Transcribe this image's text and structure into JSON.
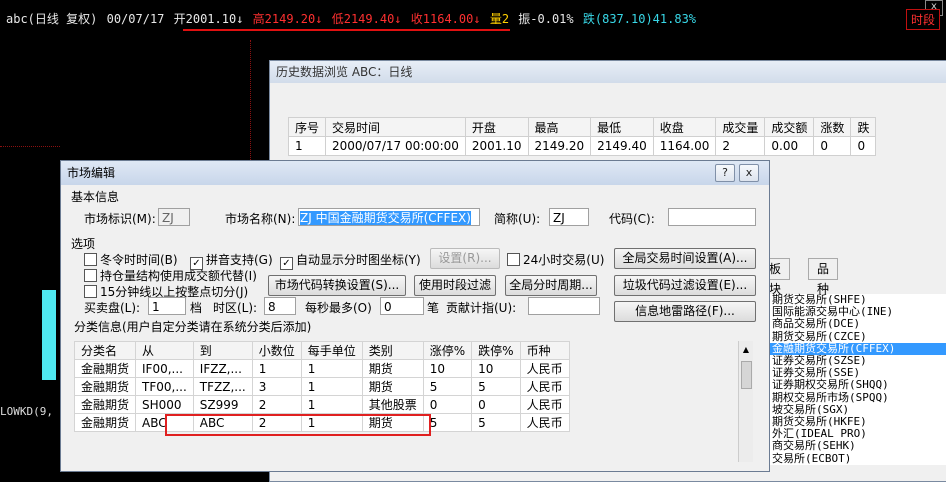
{
  "ticker": {
    "symbol": "abc(日线 复权)",
    "date": "00/07/17",
    "open": "开2001.10↓",
    "high": "高2149.20↓",
    "low": "低2149.40↓",
    "close": "收1164.00↓",
    "volume": "量2",
    "amplitude": "振-0.01%",
    "change": "跌(837.10)41.83%",
    "timeshare_button": "时段",
    "close_glyph": "x"
  },
  "chart": {
    "indicator_label": "LOWKD(9,"
  },
  "history_window": {
    "title": "历史数据浏览 ABC：日线",
    "columns": [
      "序号",
      "交易时间",
      "开盘",
      "最高",
      "最低",
      "收盘",
      "成交量",
      "成交额",
      "涨数",
      "跌"
    ],
    "rows": [
      [
        "1",
        "2000/07/17 00:00:00",
        "2001.10",
        "2149.20",
        "2149.40",
        "1164.00",
        "2",
        "0.00",
        "0",
        "0"
      ]
    ],
    "tabs": [
      "板块",
      "品种"
    ],
    "exchanges": [
      {
        "label": "期货交易所(SHFE)",
        "selected": false
      },
      {
        "label": "国际能源交易中心(INE)",
        "selected": false
      },
      {
        "label": "商品交易所(DCE)",
        "selected": false
      },
      {
        "label": "期货交易所(CZCE)",
        "selected": false
      },
      {
        "label": "金融期货交易所(CFFEX)",
        "selected": true
      },
      {
        "label": "证券交易所(SZSE)",
        "selected": false
      },
      {
        "label": "证券交易所(SSE)",
        "selected": false
      },
      {
        "label": "证券期权交易所(SHQQ)",
        "selected": false
      },
      {
        "label": "期权交易所市场(SPQQ)",
        "selected": false
      },
      {
        "label": "坡交易所(SGX)",
        "selected": false
      },
      {
        "label": "期货交易所(HKFE)",
        "selected": false
      },
      {
        "label": "外汇(IDEAL PRO)",
        "selected": false
      },
      {
        "label": "商交易所(SEHK)",
        "selected": false
      },
      {
        "label": "交易所(ECBOT)",
        "selected": false
      }
    ]
  },
  "market_dialog": {
    "title": "市场编辑",
    "help_button": "?",
    "close_button": "x",
    "basic_group": "基本信息",
    "market_id_label": "市场标识(M):",
    "market_id_value": "ZJ",
    "market_name_label": "市场名称(N):",
    "market_name_value": "ZJ 中国金融期货交易所(CFFEX)",
    "short_name_label": "简称(U):",
    "short_name_value": "ZJ",
    "code_label": "代码(C):",
    "code_value": "",
    "options_group": "选项",
    "opt_winter_time": "冬令时时间(B)",
    "opt_pinyin": "拼音支持(G)",
    "opt_auto_axis": "自动显示分时图坐标(Y)",
    "settings_button": "设置(R)...",
    "opt_24h": "24小时交易(U)",
    "global_time_button": "全局交易时间设置(A)...",
    "opt_position": "持仓量结构使用成交额代替(I)",
    "code_convert_button": "市场代码转换设置(S)...",
    "use_period_filter_button": "使用时段过滤",
    "global_period_button": "全局分时周期...",
    "junk_filter_button": "垃圾代码过滤设置(E)...",
    "opt_15min": "15分钟线以上按整点切分(J)",
    "bid_ask_label": "买卖盘(L):",
    "bid_ask_value": "1",
    "tick_label": "档",
    "timezone_label": "时区(L):",
    "timezone_value": "8",
    "per_max_label": "每秒最多(O)",
    "per_max_value": "0",
    "trade_unit_label": "笔",
    "contrib_label": "贡献计指(U):",
    "contrib_value": "",
    "info_path_button": "信息地雷路径(F)...",
    "category_group": "分类信息(用户自定分类请在系统分类后添加)",
    "table_columns": [
      "分类名",
      "从",
      "到",
      "小数位",
      "每手单位",
      "类别",
      "涨停%",
      "跌停%",
      "币种"
    ],
    "table_rows": [
      [
        "金融期货",
        "IF00,...",
        "IFZZ,...",
        "1",
        "1",
        "期货",
        "10",
        "10",
        "人民币"
      ],
      [
        "金融期货",
        "TF00,...",
        "TFZZ,...",
        "3",
        "1",
        "期货",
        "5",
        "5",
        "人民币"
      ],
      [
        "金融期货",
        "SH000",
        "SZ999",
        "2",
        "1",
        "其他股票",
        "0",
        "0",
        "人民币"
      ],
      [
        "金融期货",
        "ABC",
        "ABC",
        "2",
        "1",
        "期货",
        "5",
        "5",
        "人民币"
      ]
    ]
  }
}
